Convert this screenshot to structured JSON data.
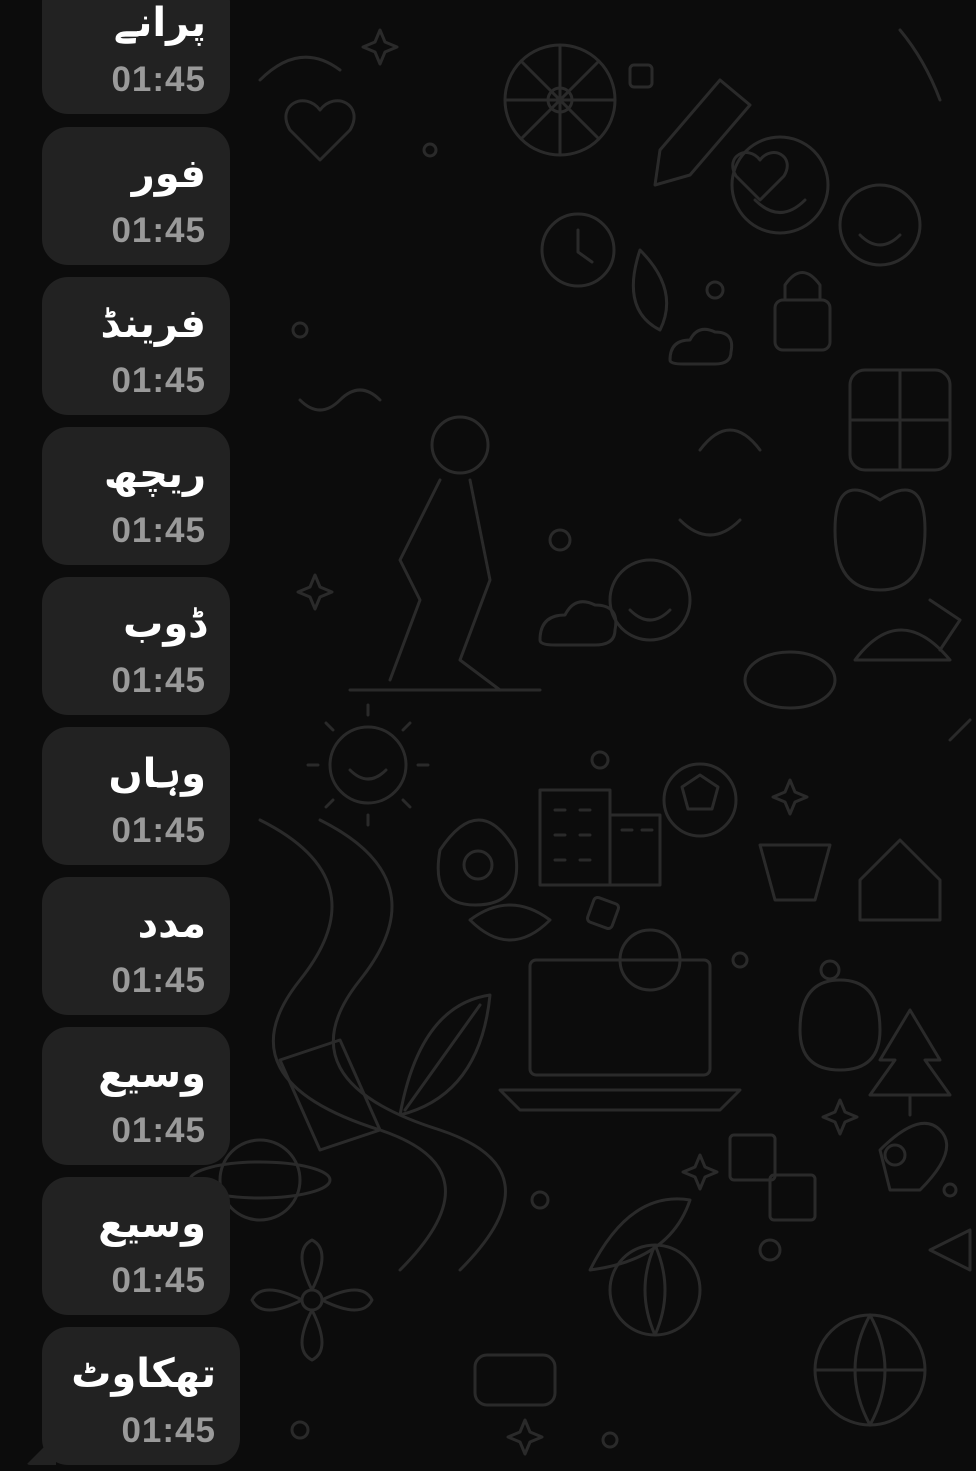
{
  "messages": [
    {
      "text": "پرانے",
      "time": "01:45"
    },
    {
      "text": "فور",
      "time": "01:45"
    },
    {
      "text": "فرینڈ",
      "time": "01:45"
    },
    {
      "text": "ریچھ",
      "time": "01:45"
    },
    {
      "text": "ڈوب",
      "time": "01:45"
    },
    {
      "text": "وہاں",
      "time": "01:45"
    },
    {
      "text": "مدد",
      "time": "01:45"
    },
    {
      "text": "وسیع",
      "time": "01:45"
    },
    {
      "text": "وسیع",
      "time": "01:45"
    },
    {
      "text": "تھکاوٹ",
      "time": "01:45"
    }
  ],
  "colors": {
    "background": "#0c0c0c",
    "bubble": "#222222",
    "text": "#ffffff",
    "timestamp": "#9a9a9a",
    "doodle": "#2a2a2a"
  }
}
